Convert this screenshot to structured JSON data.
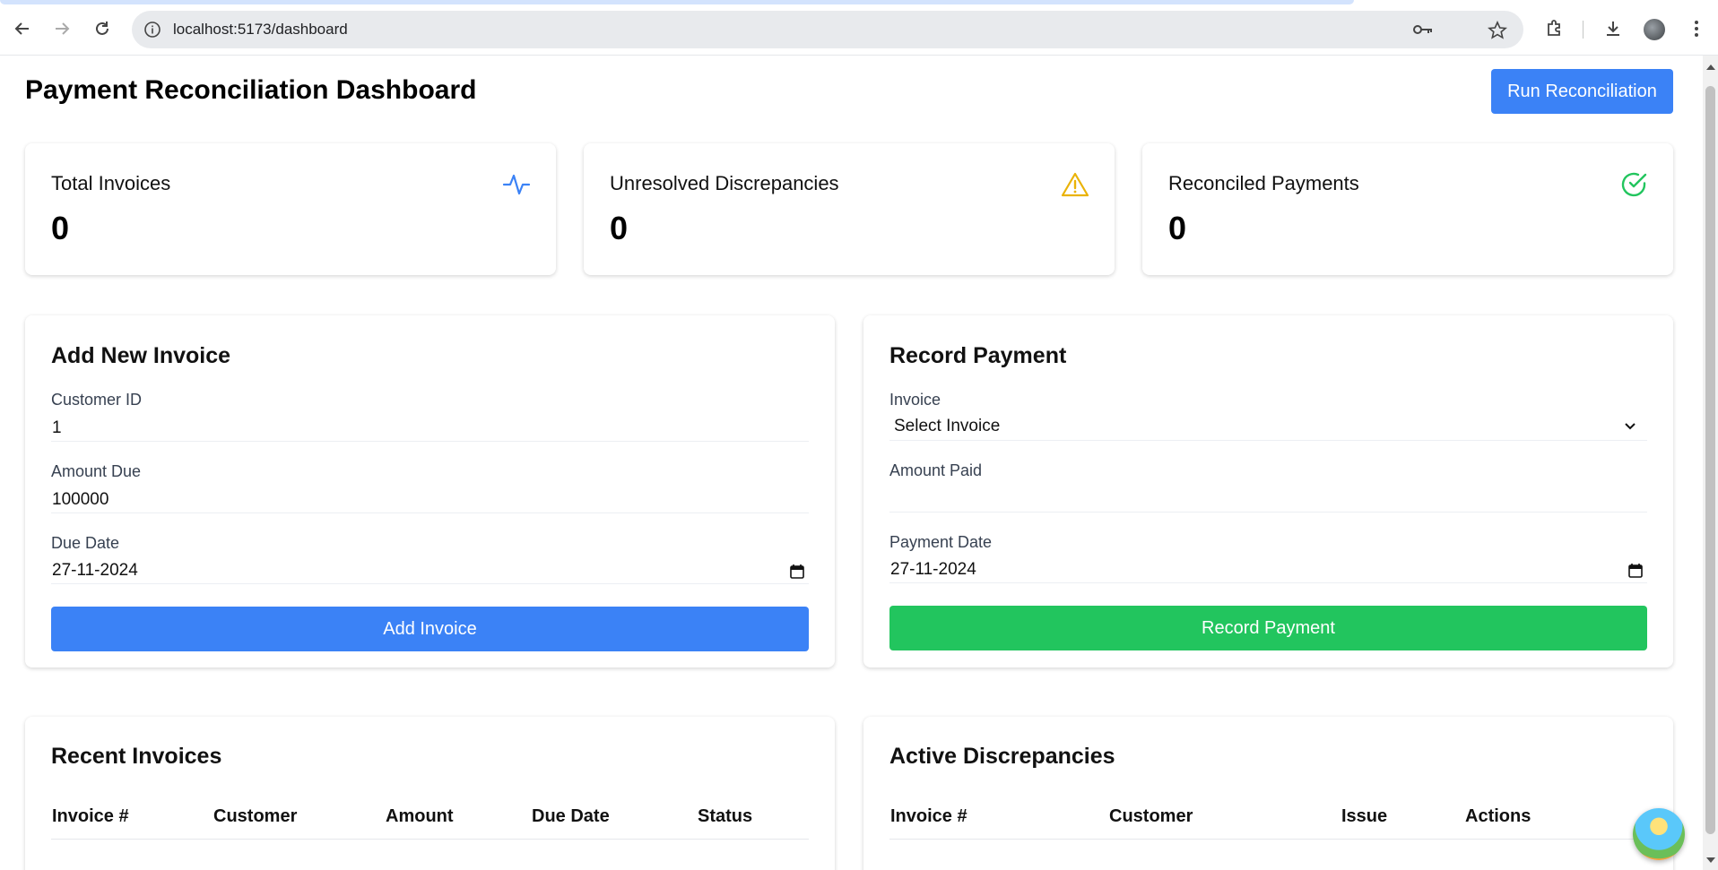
{
  "browser": {
    "url": "localhost:5173/dashboard"
  },
  "header": {
    "title": "Payment Reconciliation Dashboard",
    "run_button": "Run Reconciliation"
  },
  "stats": [
    {
      "label": "Total Invoices",
      "value": "0",
      "icon": "activity-icon",
      "color": "#3b82f6"
    },
    {
      "label": "Unresolved Discrepancies",
      "value": "0",
      "icon": "warning-triangle-icon",
      "color": "#eab308"
    },
    {
      "label": "Reconciled Payments",
      "value": "0",
      "icon": "check-circle-icon",
      "color": "#22c55e"
    }
  ],
  "invoice_form": {
    "title": "Add New Invoice",
    "customer_id_label": "Customer ID",
    "customer_id_value": "1",
    "amount_due_label": "Amount Due",
    "amount_due_value": "100000",
    "due_date_label": "Due Date",
    "due_date_value": "27-11-2024",
    "submit_label": "Add Invoice",
    "submit_color": "#3b82f6"
  },
  "payment_form": {
    "title": "Record Payment",
    "invoice_label": "Invoice",
    "invoice_selected": "Select Invoice",
    "amount_paid_label": "Amount Paid",
    "amount_paid_value": "",
    "payment_date_label": "Payment Date",
    "payment_date_value": "27-11-2024",
    "submit_label": "Record Payment",
    "submit_color": "#22c55e"
  },
  "recent_invoices": {
    "title": "Recent Invoices",
    "columns": [
      "Invoice #",
      "Customer",
      "Amount",
      "Due Date",
      "Status"
    ]
  },
  "discrepancies": {
    "title": "Active Discrepancies",
    "columns": [
      "Invoice #",
      "Customer",
      "Issue",
      "Actions"
    ]
  }
}
